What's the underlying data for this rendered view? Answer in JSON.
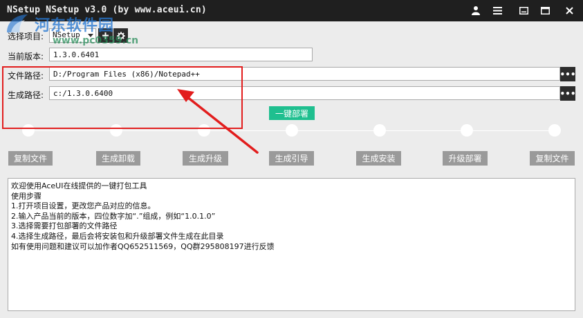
{
  "window": {
    "title": "NSetup NSetup v3.0 (by www.aceui.cn)",
    "controls": {
      "user": "user-icon",
      "menu": "menu-icon",
      "minimize": "minimize-icon",
      "maximize": "maximize-icon",
      "close": "close-icon"
    }
  },
  "watermark": {
    "text": "河东软件园",
    "url": "www.pc0359.cn"
  },
  "form": {
    "project_label": "选择项目:",
    "project_value": "NSetup",
    "version_label": "当前版本:",
    "version_value": "1.3.0.6401",
    "file_path_label": "文件路径:",
    "file_path_value": "D:/Program Files (x86)/Notepad++",
    "output_path_label": "生成路径:",
    "output_path_value": "c:/1.3.0.6400",
    "browse_label": "•••"
  },
  "deploy_button": "一键部署",
  "steps": [
    "复制文件",
    "生成卸载",
    "生成升级",
    "生成引导",
    "生成安装",
    "升级部署",
    "复制文件"
  ],
  "log_lines": [
    "欢迎使用AceUI在线提供的一键打包工具",
    "使用步骤",
    "1.打开项目设置，更改您产品对应的信息。",
    "2.输入产品当前的版本，四位数字加“.”组成，例如“1.0.1.0”",
    "3.选择需要打包部署的文件路径",
    "4.选择生成路径，最后会将安装包和升级部署文件生成在此目录",
    "如有使用问题和建议可以加作者QQ652511569，QQ群295808197进行反馈"
  ],
  "colors": {
    "titlebar": "#1f1f1f",
    "deploy_accent": "#1fbf8f",
    "step_button": "#9a9a9a",
    "annotation_red": "#e21d1d"
  }
}
